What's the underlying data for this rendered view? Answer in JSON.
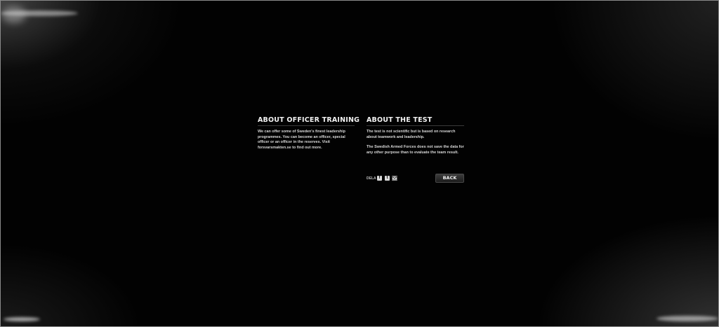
{
  "officer_training": {
    "heading": "ABOUT OFFICER TRAINING",
    "text": "We can offer some of Sweden's finest leadership programmes. You can become an officer, special officer or an officer in the reserves. Visit forsvarsmakten.se to find out more."
  },
  "about_test": {
    "heading": "ABOUT THE TEST",
    "text_1": "The test is not scientific but is based on research about teamwork and leadership.",
    "text_2": "The Swedish Armed Forces does not save the data for any other purpose than to evaluate the team result."
  },
  "share": {
    "label": "DELA",
    "facebook_glyph": "f",
    "twitter_glyph": "t",
    "icons": [
      "facebook-icon",
      "twitter-icon",
      "mail-icon"
    ]
  },
  "back_button": {
    "label": "BACK"
  },
  "colors": {
    "background": "#000000",
    "text": "#e6e6e6",
    "button": "#2a2a2a"
  }
}
